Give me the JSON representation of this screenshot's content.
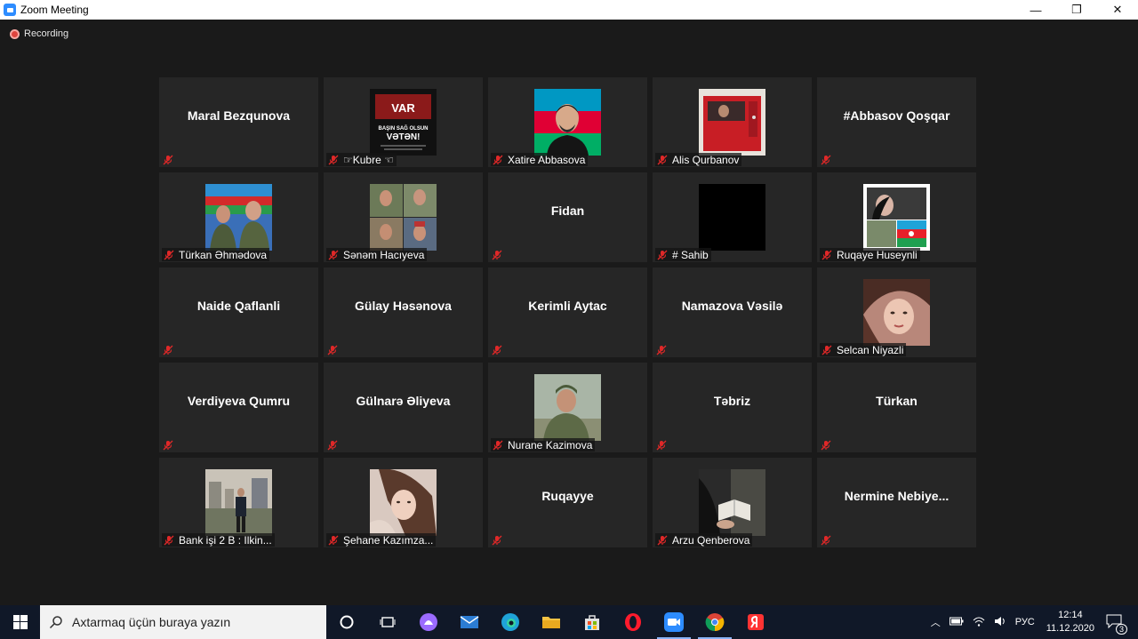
{
  "window": {
    "title": "Zoom Meeting",
    "minimize": "—",
    "restore": "❐",
    "close": "✕"
  },
  "recording": {
    "label": "Recording"
  },
  "tiles": [
    {
      "name": "Maral Bezqunova",
      "type": "text"
    },
    {
      "name": "☞Kubre ☜",
      "type": "photo",
      "photo": "poster-icon"
    },
    {
      "name": "Xatire Abbasova",
      "type": "photo",
      "photo": "person-flag-icon"
    },
    {
      "name": "Alis Qurbanov",
      "type": "photo",
      "photo": "red-car-icon"
    },
    {
      "name": "#Abbasov Qoşqar",
      "type": "text"
    },
    {
      "name": "Türkan Əhmədova",
      "type": "photo",
      "photo": "soldiers-icon"
    },
    {
      "name": "Sənəm Hacıyeva",
      "type": "photo",
      "photo": "soldiers-collage-icon"
    },
    {
      "name": "Fidan",
      "type": "text"
    },
    {
      "name": "# Sahib",
      "type": "photo",
      "photo": "black-video-icon"
    },
    {
      "name": "Ruqaye Huseynli",
      "type": "photo",
      "photo": "portrait-flag-icon"
    },
    {
      "name": "Naide Qaflanli",
      "type": "text"
    },
    {
      "name": "Gülay Həsənova",
      "type": "text"
    },
    {
      "name": "Kerimli Aytac",
      "type": "text"
    },
    {
      "name": "Namazova Vəsilə",
      "type": "text"
    },
    {
      "name": "Selcan Niyazli",
      "type": "photo",
      "photo": "girl-portrait-icon"
    },
    {
      "name": "Verdiyeva Qumru",
      "type": "text"
    },
    {
      "name": "Gülnarə Əliyeva",
      "type": "text"
    },
    {
      "name": "Nurane Kazimova",
      "type": "photo",
      "photo": "soldier-portrait-icon"
    },
    {
      "name": "Təbriz",
      "type": "text"
    },
    {
      "name": "Türkan",
      "type": "text"
    },
    {
      "name": "Bank işi 2 B : Ilkin...",
      "type": "photo",
      "photo": "man-city-icon"
    },
    {
      "name": "Şehane Kazımza...",
      "type": "photo",
      "photo": "girl-hair-icon"
    },
    {
      "name": "Ruqayye",
      "type": "text"
    },
    {
      "name": "Arzu Qenberova",
      "type": "photo",
      "photo": "reading-book-icon"
    },
    {
      "name": "Nermine  Nebiye...",
      "type": "text"
    }
  ],
  "taskbar": {
    "search_placeholder": "Axtarmaq üçün buraya yazın",
    "language": "РУС",
    "time": "12:14",
    "date": "11.12.2020",
    "notifications": "3"
  }
}
